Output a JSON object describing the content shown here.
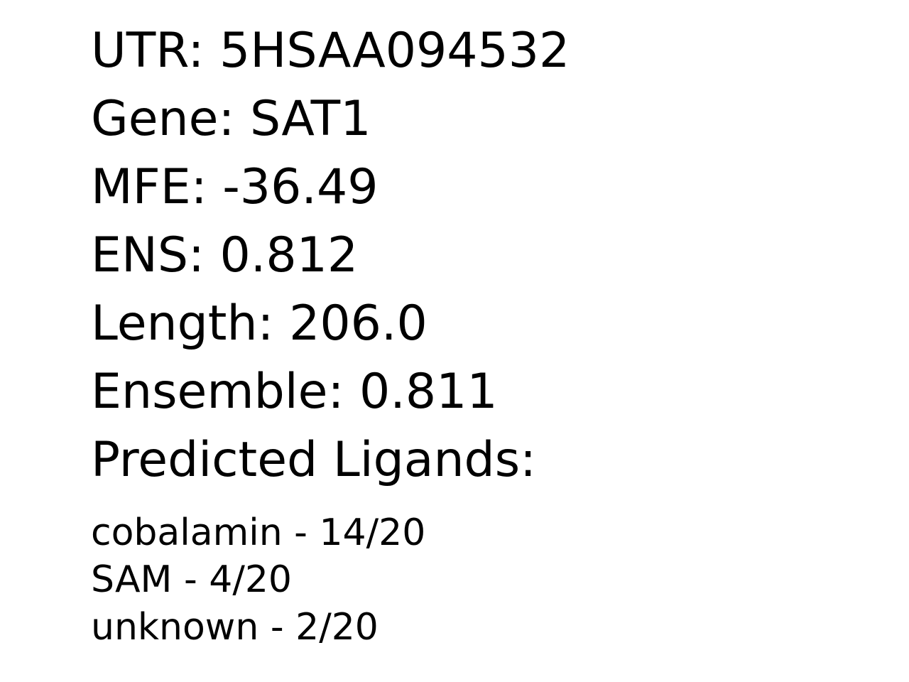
{
  "summary": {
    "utr": "UTR: 5HSAA094532",
    "gene": "Gene: SAT1",
    "mfe": "MFE: -36.49",
    "ens": "ENS: 0.812",
    "length": "Length: 206.0",
    "ensemble": "Ensemble: 0.811",
    "ligands_heading": "Predicted Ligands:"
  },
  "ligands": [
    "cobalamin - 14/20",
    "SAM - 4/20",
    "unknown - 2/20"
  ]
}
